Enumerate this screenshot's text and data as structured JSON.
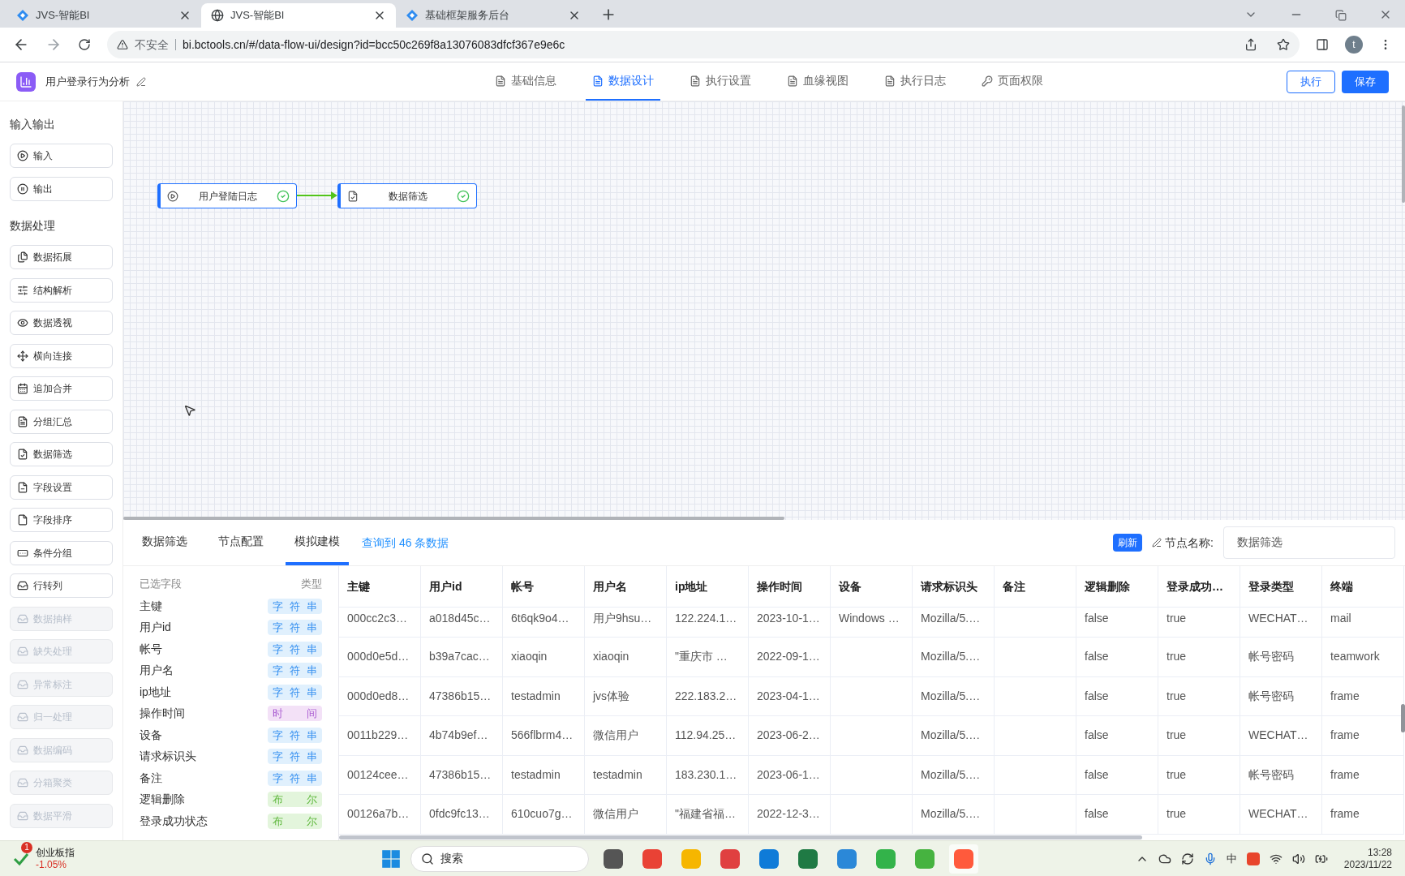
{
  "browser": {
    "tabs": [
      {
        "title": "JVS-智能BI",
        "selected": false
      },
      {
        "title": "JVS-智能BI",
        "selected": true
      },
      {
        "title": "基础框架服务后台",
        "selected": false
      }
    ],
    "security": "不安全",
    "url": "bi.bctools.cn/#/data-flow-ui/design?id=bcc50c269f8a13076083dfcf367e9e6c",
    "profile": "t"
  },
  "header": {
    "title": "用户登录行为分析",
    "tabs": [
      {
        "label": "基础信息",
        "selected": false
      },
      {
        "label": "数据设计",
        "selected": true
      },
      {
        "label": "执行设置",
        "selected": false
      },
      {
        "label": "血缘视图",
        "selected": false
      },
      {
        "label": "执行日志",
        "selected": false
      },
      {
        "label": "页面权限",
        "selected": false
      }
    ],
    "buttons": [
      {
        "label": "执行",
        "kind": "outline"
      },
      {
        "label": "保存",
        "kind": "primary"
      }
    ]
  },
  "sidebar": {
    "sections": [
      {
        "title": "输入输出",
        "items": [
          {
            "label": "输入",
            "disabled": false
          },
          {
            "label": "输出",
            "disabled": false
          }
        ]
      },
      {
        "title": "数据处理",
        "items": [
          {
            "label": "数据拓展",
            "disabled": false
          },
          {
            "label": "结构解析",
            "disabled": false
          },
          {
            "label": "数据透视",
            "disabled": false
          },
          {
            "label": "横向连接",
            "disabled": false
          },
          {
            "label": "追加合并",
            "disabled": false
          },
          {
            "label": "分组汇总",
            "disabled": false
          },
          {
            "label": "数据筛选",
            "disabled": false
          },
          {
            "label": "字段设置",
            "disabled": false
          },
          {
            "label": "字段排序",
            "disabled": false
          },
          {
            "label": "条件分组",
            "disabled": false
          },
          {
            "label": "行转列",
            "disabled": false
          },
          {
            "label": "数据抽样",
            "disabled": true
          },
          {
            "label": "缺失处理",
            "disabled": true
          },
          {
            "label": "异常标注",
            "disabled": true
          },
          {
            "label": "归一处理",
            "disabled": true
          },
          {
            "label": "数据编码",
            "disabled": true
          },
          {
            "label": "分箱聚类",
            "disabled": true
          },
          {
            "label": "数据平滑",
            "disabled": true
          }
        ]
      }
    ]
  },
  "canvas": {
    "nodes": [
      {
        "label": "用户登陆日志",
        "kind": "input"
      },
      {
        "label": "数据筛选",
        "kind": "filter"
      }
    ]
  },
  "panel": {
    "tabs": [
      {
        "label": "数据筛选",
        "selected": false
      },
      {
        "label": "节点配置",
        "selected": false
      },
      {
        "label": "模拟建模",
        "selected": true
      }
    ],
    "result": "查询到 46 条数据",
    "refresh": "刷新",
    "name_label": "节点名称:",
    "name_value": "数据筛选",
    "fields_header": "已选字段",
    "type_header": "类型",
    "fields": [
      {
        "name": "主键",
        "type": "字符串",
        "kind": "string"
      },
      {
        "name": "用户id",
        "type": "字符串",
        "kind": "string"
      },
      {
        "name": "帐号",
        "type": "字符串",
        "kind": "string"
      },
      {
        "name": "用户名",
        "type": "字符串",
        "kind": "string"
      },
      {
        "name": "ip地址",
        "type": "字符串",
        "kind": "string"
      },
      {
        "name": "操作时间",
        "type": "时间",
        "kind": "time"
      },
      {
        "name": "设备",
        "type": "字符串",
        "kind": "string"
      },
      {
        "name": "请求标识头",
        "type": "字符串",
        "kind": "string"
      },
      {
        "name": "备注",
        "type": "字符串",
        "kind": "string"
      },
      {
        "name": "逻辑删除",
        "type": "布尔",
        "kind": "bool"
      },
      {
        "name": "登录成功状态",
        "type": "布尔",
        "kind": "bool"
      }
    ],
    "table": {
      "columns": [
        "主键",
        "用户id",
        "帐号",
        "用户名",
        "ip地址",
        "操作时间",
        "设备",
        "请求标识头",
        "备注",
        "逻辑删除",
        "登录成功…",
        "登录类型",
        "终端"
      ],
      "rows": [
        [
          "000cc2c3…",
          "a018d45c…",
          "6t6qk9o4…",
          "用户9hsu…",
          "122.224.1…",
          "2023-10-1…",
          "Windows …",
          "Mozilla/5.…",
          "",
          "false",
          "true",
          "WECHAT…",
          "mail"
        ],
        [
          "000d0e5d…",
          "b39a7cac…",
          "xiaoqin",
          "xiaoqin",
          "\"重庆市 …",
          "2022-09-1…",
          "",
          "Mozilla/5.…",
          "",
          "false",
          "true",
          "帐号密码",
          "teamwork"
        ],
        [
          "000d0ed8…",
          "47386b15…",
          "testadmin",
          "jvs体验",
          "222.183.2…",
          "2023-04-1…",
          "",
          "Mozilla/5.…",
          "",
          "false",
          "true",
          "帐号密码",
          "frame"
        ],
        [
          "0011b229…",
          "4b74b9ef…",
          "566flbrm4…",
          "微信用户",
          "112.94.25…",
          "2023-06-2…",
          "",
          "Mozilla/5.…",
          "",
          "false",
          "true",
          "WECHAT…",
          "frame"
        ],
        [
          "00124cee…",
          "47386b15…",
          "testadmin",
          "testadmin",
          "183.230.1…",
          "2023-06-1…",
          "",
          "Mozilla/5.…",
          "",
          "false",
          "true",
          "帐号密码",
          "frame"
        ],
        [
          "00126a7b…",
          "0fdc9fc13…",
          "610cuo7g…",
          "微信用户",
          "\"福建省福…",
          "2022-12-3…",
          "",
          "Mozilla/5.…",
          "",
          "false",
          "true",
          "WECHAT…",
          "frame"
        ]
      ]
    }
  },
  "taskbar": {
    "widget": {
      "name": "创业板指",
      "change": "-1.05%",
      "badge": "1"
    },
    "search": "搜索",
    "ime": "中",
    "time": "13:28",
    "date": "2023/11/22"
  }
}
